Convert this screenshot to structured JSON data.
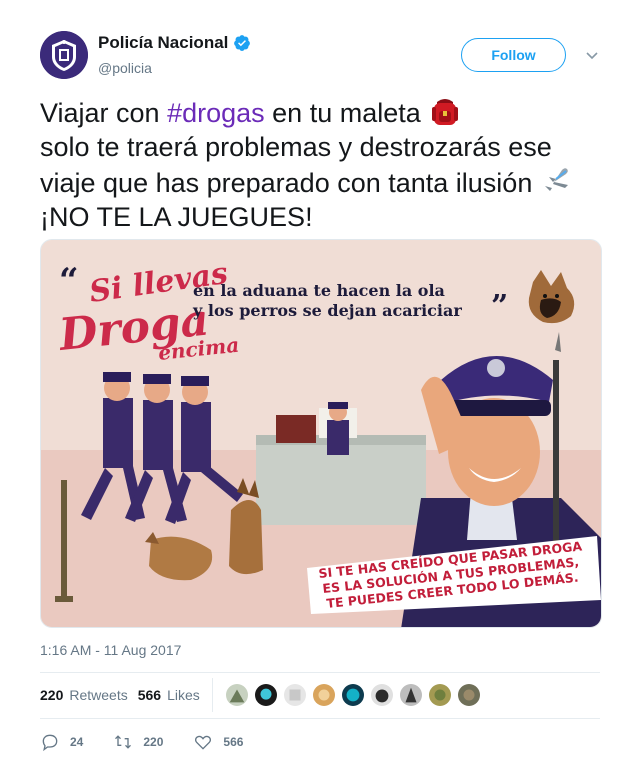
{
  "account": {
    "display_name": "Policía Nacional",
    "handle": "@policia",
    "verified_icon": "verified-badge-icon",
    "follow_label": "Follow"
  },
  "tweet": {
    "text_line1_pre": "Viajar con ",
    "hashtag": "#drogas",
    "text_line1_post": " en tu maleta",
    "text_line2": "solo te traerá problemas y destrozarás ese",
    "text_line3": "viaje que has preparado con tanta ilusión",
    "text_line4": "¡NO TE LA JUEGUES!",
    "emoji1": "backpack-emoji",
    "emoji2": "airplane-emoji"
  },
  "media": {
    "quote_top_left_1": "Si llevas",
    "quote_top_left_2": "Droga",
    "quote_top_left_3": "encima",
    "quote_line1": "en la aduana te hacen la ola",
    "quote_line2": "y los perros se dejan acariciar",
    "banner_line1": "SI TE HAS CREÍDO QUE PASAR DROGA",
    "banner_line2": "ES LA SOLUCIÓN A TUS PROBLEMAS,",
    "banner_line3": "TE PUEDES CREER TODO LO DEMÁS."
  },
  "timestamp": "1:16 AM - 11 Aug 2017",
  "stats": {
    "retweets_count": "220",
    "retweets_label": "Retweets",
    "likes_count": "566",
    "likes_label": "Likes"
  },
  "actions": {
    "reply_count": "24",
    "retweet_count": "220",
    "like_count": "566"
  },
  "colors": {
    "accent": "#1da1f2",
    "hashtag": "#6b2bb8",
    "muted": "#657786"
  }
}
